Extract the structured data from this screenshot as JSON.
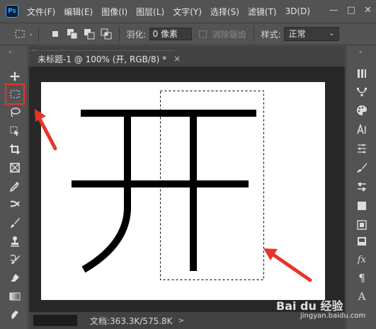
{
  "menubar": {
    "logo": "Ps",
    "items": [
      "文件(F)",
      "编辑(E)",
      "图像(I)",
      "图层(L)",
      "文字(Y)",
      "选择(S)",
      "滤镜(T)",
      "3D(D)"
    ],
    "window_controls": [
      "—",
      "□",
      "✕"
    ]
  },
  "options": {
    "feather_label": "羽化:",
    "feather_value": "0 像素",
    "antialias_label": "消除锯齿",
    "style_label": "样式:",
    "style_value": "正常"
  },
  "document": {
    "tab_title": "未标题-1 @ 100% (开, RGB/8) *",
    "close_glyph": "×",
    "canvas_text": "开"
  },
  "status": {
    "doc_info": "文档:363.3K/575.8K",
    "arrow": ">"
  },
  "watermark": {
    "brand": "Bai du 经验",
    "url": "jingyan.baidu.com"
  },
  "annotation": {
    "highlight_color": "#e8332a",
    "arrow_color": "#e8332a"
  },
  "tools_left": [
    "move-icon",
    "rect-marquee-icon",
    "lasso-icon",
    "object-select-icon",
    "crop-icon",
    "frame-icon",
    "eyedropper-icon",
    "healing-icon",
    "brush-icon",
    "stamp-icon",
    "history-brush-icon",
    "eraser-icon",
    "gradient-icon",
    "smudge-icon"
  ],
  "tools_right": [
    "navigator-icon",
    "path-icon",
    "color-palette-icon",
    "character-icon",
    "paragraph-adjust-icon",
    "brushes-icon",
    "adjustments-icon",
    "layers-icon",
    "channels-icon",
    "swatches-icon",
    "fx-icon",
    "pilcrow-icon",
    "glyphs-icon"
  ]
}
